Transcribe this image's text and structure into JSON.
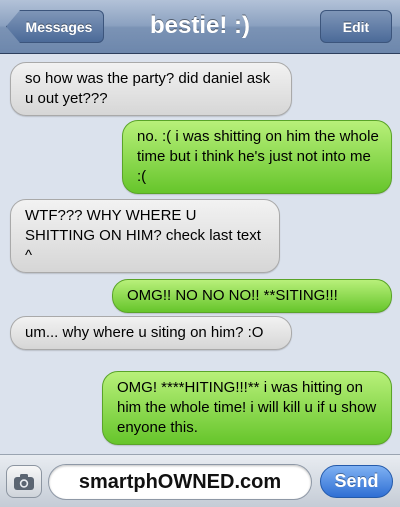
{
  "navbar": {
    "back_label": "Messages",
    "title": "bestie! :)",
    "edit_label": "Edit"
  },
  "messages": [
    {
      "direction": "incoming",
      "text": "so how was the party? did daniel ask u out yet???"
    },
    {
      "direction": "outgoing",
      "text": "no. :( i was shitting on him the whole time but i think he's just not into me :("
    },
    {
      "direction": "incoming",
      "text": "WTF??? WHY WHERE U SHITTING ON HIM? check last text ^"
    },
    {
      "direction": "outgoing",
      "text": "OMG!! NO NO NO!! **SITING!!!"
    },
    {
      "direction": "incoming",
      "text": "um... why where u siting on him? :O"
    },
    {
      "direction": "outgoing",
      "text": "OMG! ****HITING!!!** i was hitting on him the whole time! i will kill u if u show enyone this."
    }
  ],
  "composer": {
    "input_value": "smartphOWNED.com",
    "send_label": "Send",
    "camera_icon": "camera-icon"
  },
  "colors": {
    "incoming_bubble": "#e6e6e6",
    "outgoing_bubble": "#8cd84f",
    "navbar": "#8ba1c0",
    "send_button": "#2f6fd4"
  }
}
